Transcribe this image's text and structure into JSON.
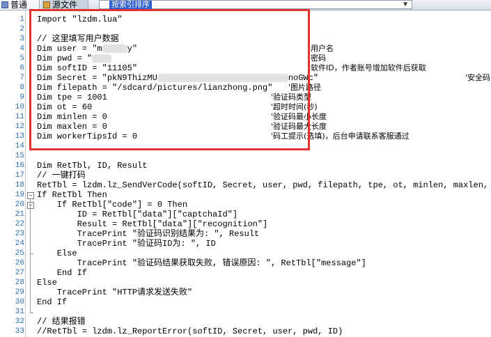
{
  "tabs": {
    "normal_label": "普通",
    "source_label": "源文件",
    "combo_value": "按索引排序"
  },
  "colors": {
    "highlight_border": "#e0342f",
    "comment_green": "#1a7a1a",
    "line_number": "#2b6fb0"
  },
  "icons": {
    "normal_tab": "page-icon",
    "source_tab": "file-icon",
    "combo": "chevron-down-icon",
    "fold_collapse": "minus-box-icon"
  },
  "editor": {
    "line_numbers": [
      "1",
      "2",
      "3",
      "4",
      "5",
      "6",
      "7",
      "8",
      "9",
      "10",
      "11",
      "12",
      "13",
      "14",
      "15",
      "16",
      "17",
      "18",
      "19",
      "20",
      "21",
      "22",
      "23",
      "24",
      "25",
      "26",
      "27",
      "28",
      "29",
      "30",
      "31",
      "32",
      "33"
    ],
    "lines": [
      "Import \"lzdm.lua\"",
      "",
      "// 这里填写用户数据",
      "Dim user = \"m",
      "Dim pwd = \"",
      "Dim softID = \"11105\"",
      "Dim Secret = \"pkN9ThizMU",
      "Dim filepath = \"/sdcard/pictures/lianzhong.png\"",
      "Dim tpe = 1001",
      "Dim ot = 60",
      "Dim minlen = 0",
      "Dim maxlen = 0",
      "Dim workerTipsId = 0",
      "",
      "",
      "Dim RetTbl, ID, Result",
      "// 一键打码",
      "RetTbl = lzdm.lz_SendVerCode(softID, Secret, user, pwd, filepath, tpe, ot, minlen, maxlen, wo",
      "If RetTbl Then",
      "    If RetTbl[\"code\"] = 0 Then",
      "        ID = RetTbl[\"data\"][\"captchaId\"]",
      "        Result = RetTbl[\"data\"][\"recognition\"]",
      "        TracePrint \"验证码识别结果为: \", Result",
      "        TracePrint \"验证码ID为: \", ID",
      "    Else",
      "        TracePrint \"验证码结果获取失败, 错误原因: \", RetTbl[\"message\"]",
      "    End If",
      "Else",
      "    TracePrint \"HTTP请求发送失败\"",
      "End If",
      "",
      "// 结果报错",
      "//RetTbl = lzdm.lz_ReportError(softID, Secret, user, pwd, ID)"
    ],
    "line_tails": {
      "user_tail": "y\"",
      "secret_tail": "noGWc\""
    },
    "trailing_comments": {
      "user": "'用户名",
      "pwd": "'密码",
      "softid": "'软件ID，作者账号增加软件后获取",
      "secret": "'安全码",
      "filepath": "'图片路径",
      "tpe": "'验证码类型",
      "ot": "'超时时间(秒)",
      "minlen": "'验证码最小长度",
      "maxlen": "'验证码最大长度",
      "worker": "'码工提示(选填)，后台申请联系客服通过"
    }
  }
}
